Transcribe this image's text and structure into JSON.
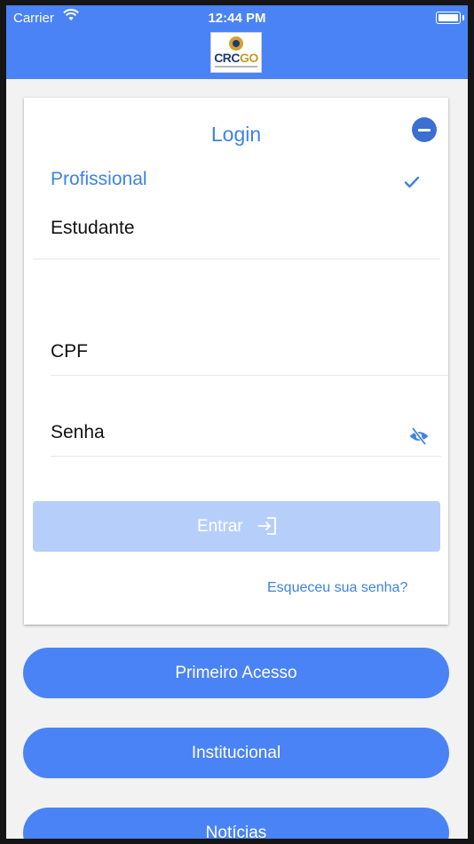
{
  "status_bar": {
    "carrier": "Carrier",
    "time": "12:44 PM"
  },
  "header": {
    "logo_text_crc": "CRC",
    "logo_text_go": "GO",
    "brand_color": "#4a83f5"
  },
  "login": {
    "title": "Login",
    "options": [
      {
        "label": "Profissional",
        "selected": true
      },
      {
        "label": "Estudante",
        "selected": false
      }
    ],
    "cpf_label": "CPF",
    "password_label": "Senha",
    "submit_label": "Entrar",
    "forgot_label": "Esqueceu sua senha?"
  },
  "menu": {
    "buttons": [
      "Primeiro Acesso",
      "Institucional",
      "Notícias"
    ]
  },
  "icons": [
    "wifi-icon",
    "battery-icon",
    "collapse-icon",
    "checkmark-icon",
    "eye-off-icon",
    "login-arrow-icon"
  ]
}
